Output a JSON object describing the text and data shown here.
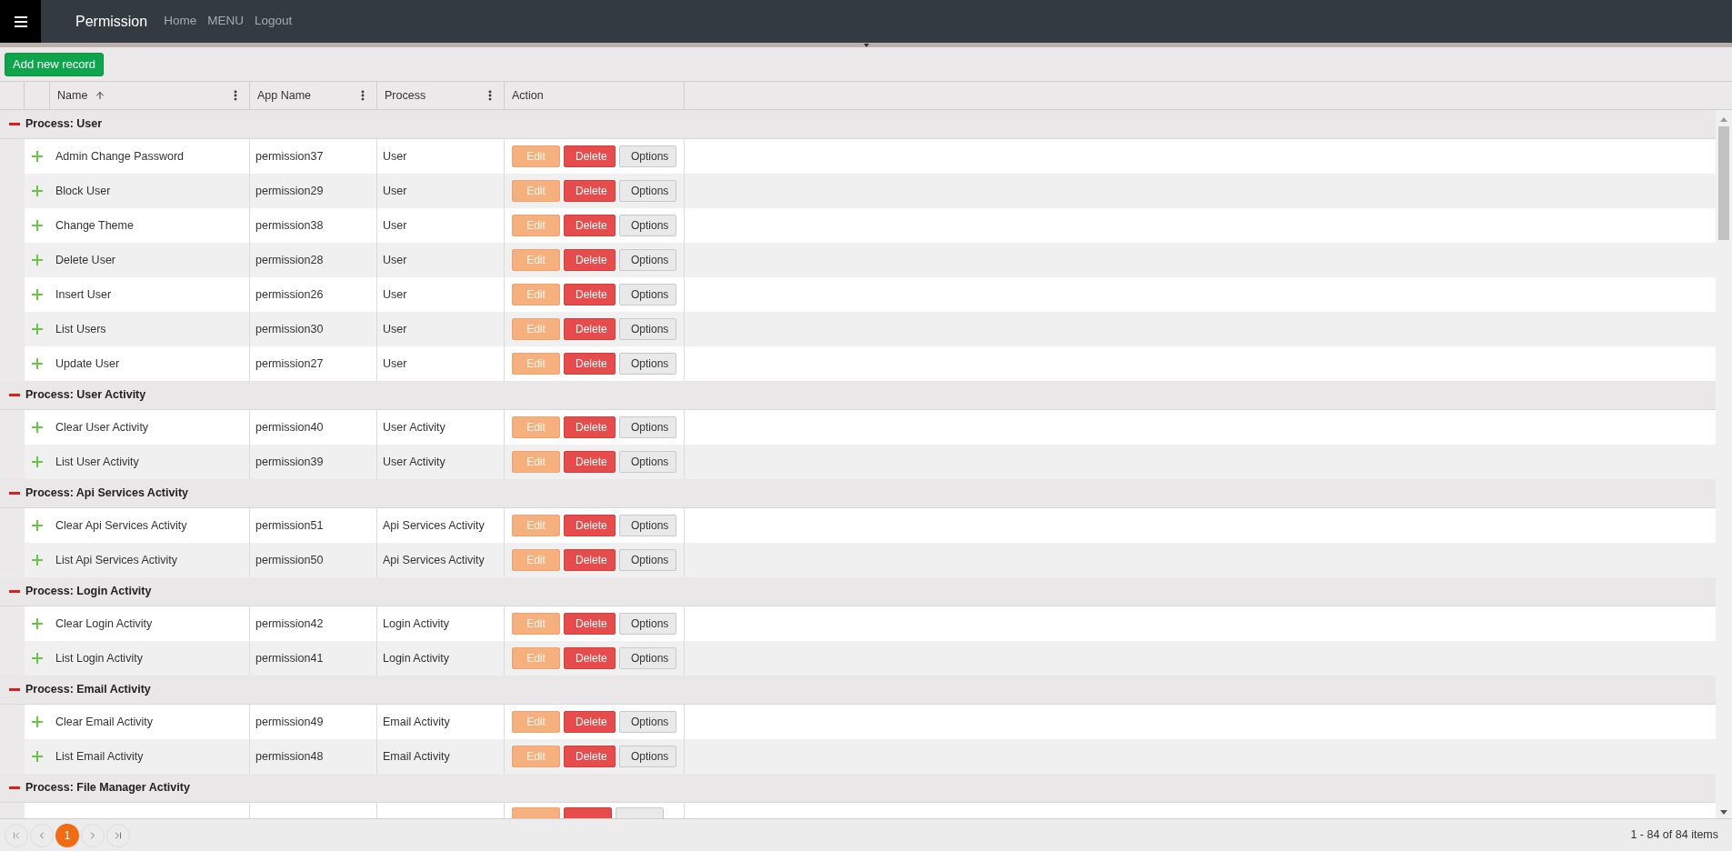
{
  "header": {
    "title": "Permission",
    "nav": [
      "Home",
      "MENU",
      "Logout"
    ]
  },
  "toolbar": {
    "add_button": "Add new record"
  },
  "columns": [
    {
      "label": "Name",
      "sorted": true,
      "menu": true
    },
    {
      "label": "App Name",
      "sorted": false,
      "menu": true
    },
    {
      "label": "Process",
      "sorted": false,
      "menu": true
    },
    {
      "label": "Action",
      "sorted": false,
      "menu": false
    }
  ],
  "groups": [
    {
      "label": "Process: User",
      "expanded": true,
      "rows": [
        {
          "name": "Admin Change Password",
          "app_name": "permission37",
          "process": "User",
          "actions": [
            {
              "label": "Edit",
              "kind": "edit"
            },
            {
              "label": "Delete",
              "kind": "delete"
            },
            {
              "label": "Options",
              "kind": "options"
            }
          ]
        },
        {
          "name": "Block User",
          "app_name": "permission29",
          "process": "User",
          "actions": [
            {
              "label": "Edit",
              "kind": "edit"
            },
            {
              "label": "Delete",
              "kind": "delete"
            },
            {
              "label": "Options",
              "kind": "options"
            }
          ]
        },
        {
          "name": "Change Theme",
          "app_name": "permission38",
          "process": "User",
          "actions": [
            {
              "label": "Edit",
              "kind": "edit"
            },
            {
              "label": "Delete",
              "kind": "delete"
            },
            {
              "label": "Options",
              "kind": "options"
            }
          ]
        },
        {
          "name": "Delete User",
          "app_name": "permission28",
          "process": "User",
          "actions": [
            {
              "label": "Edit",
              "kind": "edit"
            },
            {
              "label": "Delete",
              "kind": "delete"
            },
            {
              "label": "Options",
              "kind": "options"
            }
          ]
        },
        {
          "name": "Insert User",
          "app_name": "permission26",
          "process": "User",
          "actions": [
            {
              "label": "Edit",
              "kind": "edit"
            },
            {
              "label": "Delete",
              "kind": "delete"
            },
            {
              "label": "Options",
              "kind": "options"
            }
          ]
        },
        {
          "name": "List Users",
          "app_name": "permission30",
          "process": "User",
          "actions": [
            {
              "label": "Edit",
              "kind": "edit"
            },
            {
              "label": "Delete",
              "kind": "delete"
            },
            {
              "label": "Options",
              "kind": "options"
            }
          ]
        },
        {
          "name": "Update User",
          "app_name": "permission27",
          "process": "User",
          "actions": [
            {
              "label": "Edit",
              "kind": "edit"
            },
            {
              "label": "Delete",
              "kind": "delete"
            },
            {
              "label": "Options",
              "kind": "options"
            }
          ]
        }
      ]
    },
    {
      "label": "Process: User Activity",
      "expanded": true,
      "rows": [
        {
          "name": "Clear User Activity",
          "app_name": "permission40",
          "process": "User Activity",
          "actions": [
            {
              "label": "Edit",
              "kind": "edit"
            },
            {
              "label": "Delete",
              "kind": "delete"
            },
            {
              "label": "Options",
              "kind": "options"
            }
          ]
        },
        {
          "name": "List User Activity",
          "app_name": "permission39",
          "process": "User Activity",
          "actions": [
            {
              "label": "Edit",
              "kind": "edit"
            },
            {
              "label": "Delete",
              "kind": "delete"
            },
            {
              "label": "Options",
              "kind": "options"
            }
          ]
        }
      ]
    },
    {
      "label": "Process: Api Services Activity",
      "expanded": true,
      "rows": [
        {
          "name": "Clear Api Services Activity",
          "app_name": "permission51",
          "process": "Api Services Activity",
          "actions": [
            {
              "label": "Edit",
              "kind": "edit"
            },
            {
              "label": "Delete",
              "kind": "delete"
            },
            {
              "label": "Options",
              "kind": "options"
            }
          ]
        },
        {
          "name": "List Api Services Activity",
          "app_name": "permission50",
          "process": "Api Services Activity",
          "actions": [
            {
              "label": "Edit",
              "kind": "edit"
            },
            {
              "label": "Delete",
              "kind": "delete"
            },
            {
              "label": "Options",
              "kind": "options"
            }
          ]
        }
      ]
    },
    {
      "label": "Process: Login Activity",
      "expanded": true,
      "rows": [
        {
          "name": "Clear Login Activity",
          "app_name": "permission42",
          "process": "Login Activity",
          "actions": [
            {
              "label": "Edit",
              "kind": "edit"
            },
            {
              "label": "Delete",
              "kind": "delete"
            },
            {
              "label": "Options",
              "kind": "options"
            }
          ]
        },
        {
          "name": "List Login Activity",
          "app_name": "permission41",
          "process": "Login Activity",
          "actions": [
            {
              "label": "Edit",
              "kind": "edit"
            },
            {
              "label": "Delete",
              "kind": "delete"
            },
            {
              "label": "Options",
              "kind": "options"
            }
          ]
        }
      ]
    },
    {
      "label": "Process: Email Activity",
      "expanded": true,
      "rows": [
        {
          "name": "Clear Email Activity",
          "app_name": "permission49",
          "process": "Email Activity",
          "actions": [
            {
              "label": "Edit",
              "kind": "edit"
            },
            {
              "label": "Delete",
              "kind": "delete"
            },
            {
              "label": "Options",
              "kind": "options"
            }
          ]
        },
        {
          "name": "List Email Activity",
          "app_name": "permission48",
          "process": "Email Activity",
          "actions": [
            {
              "label": "Edit",
              "kind": "edit"
            },
            {
              "label": "Delete",
              "kind": "delete"
            },
            {
              "label": "Options",
              "kind": "options"
            }
          ]
        }
      ]
    },
    {
      "label": "Process: File Manager Activity",
      "expanded": true,
      "rows": [
        {
          "kind": "clipped",
          "actions": [
            {
              "kind": "edit"
            },
            {
              "kind": "delete"
            },
            {
              "kind": "options"
            }
          ]
        }
      ]
    }
  ],
  "pager": {
    "pages": [
      {
        "label": "1",
        "selected": true
      }
    ],
    "summary": "1 - 84 of 84 items"
  }
}
